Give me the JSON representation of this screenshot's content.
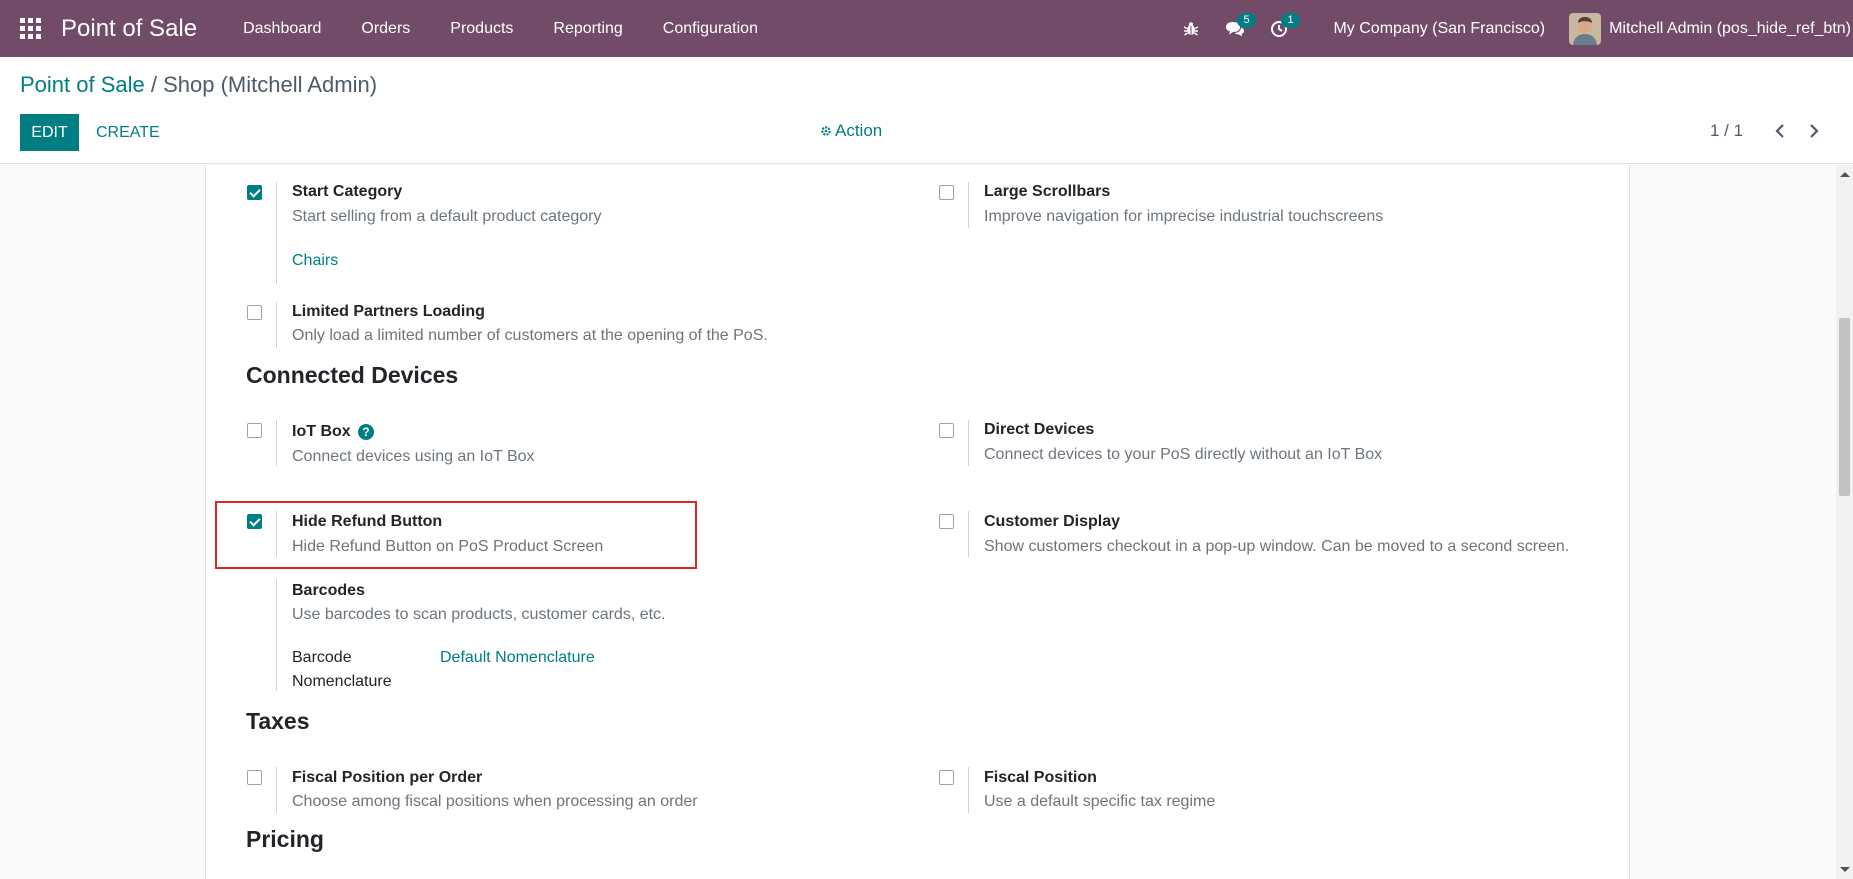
{
  "navbar": {
    "app_name": "Point of Sale",
    "menu": [
      "Dashboard",
      "Orders",
      "Products",
      "Reporting",
      "Configuration"
    ],
    "messages_count": "5",
    "activities_count": "1",
    "company": "My Company (San Francisco)",
    "user": "Mitchell Admin (pos_hide_ref_btn)"
  },
  "control_panel": {
    "breadcrumb_root": "Point of Sale",
    "breadcrumb_sep": " / ",
    "breadcrumb_current": "Shop (Mitchell Admin)",
    "edit_label": "EDIT",
    "create_label": "CREATE",
    "action_label": "Action",
    "pager": "1 / 1"
  },
  "settings": {
    "start_category": {
      "title": "Start Category",
      "desc": "Start selling from a default product category",
      "value": "Chairs",
      "checked": true
    },
    "large_scrollbars": {
      "title": "Large Scrollbars",
      "desc": "Improve navigation for imprecise industrial touchscreens",
      "checked": false
    },
    "limited_partners": {
      "title": "Limited Partners Loading",
      "desc": "Only load a limited number of customers at the opening of the PoS.",
      "checked": false
    },
    "connected_devices_title": "Connected Devices",
    "iot_box": {
      "title": "IoT Box",
      "desc": "Connect devices using an IoT Box",
      "checked": false
    },
    "direct_devices": {
      "title": "Direct Devices",
      "desc": "Connect devices to your PoS directly without an IoT Box",
      "checked": false
    },
    "hide_refund": {
      "title": "Hide Refund Button",
      "desc": "Hide Refund Button on PoS Product Screen",
      "checked": true
    },
    "customer_display": {
      "title": "Customer Display",
      "desc": "Show customers checkout in a pop-up window. Can be moved to a second screen.",
      "checked": false
    },
    "barcodes": {
      "title": "Barcodes",
      "desc": "Use barcodes to scan products, customer cards, etc.",
      "nomenclature_label_1": "Barcode",
      "nomenclature_label_2": "Nomenclature",
      "nomenclature_value": "Default Nomenclature"
    },
    "taxes_title": "Taxes",
    "fiscal_per_order": {
      "title": "Fiscal Position per Order",
      "desc": "Choose among fiscal positions when processing an order",
      "checked": false
    },
    "fiscal_position": {
      "title": "Fiscal Position",
      "desc": "Use a default specific tax regime",
      "checked": false
    },
    "pricing_title": "Pricing"
  },
  "colors": {
    "navbar": "#714b67",
    "accent": "#017e84",
    "highlight": "#e0262b"
  }
}
